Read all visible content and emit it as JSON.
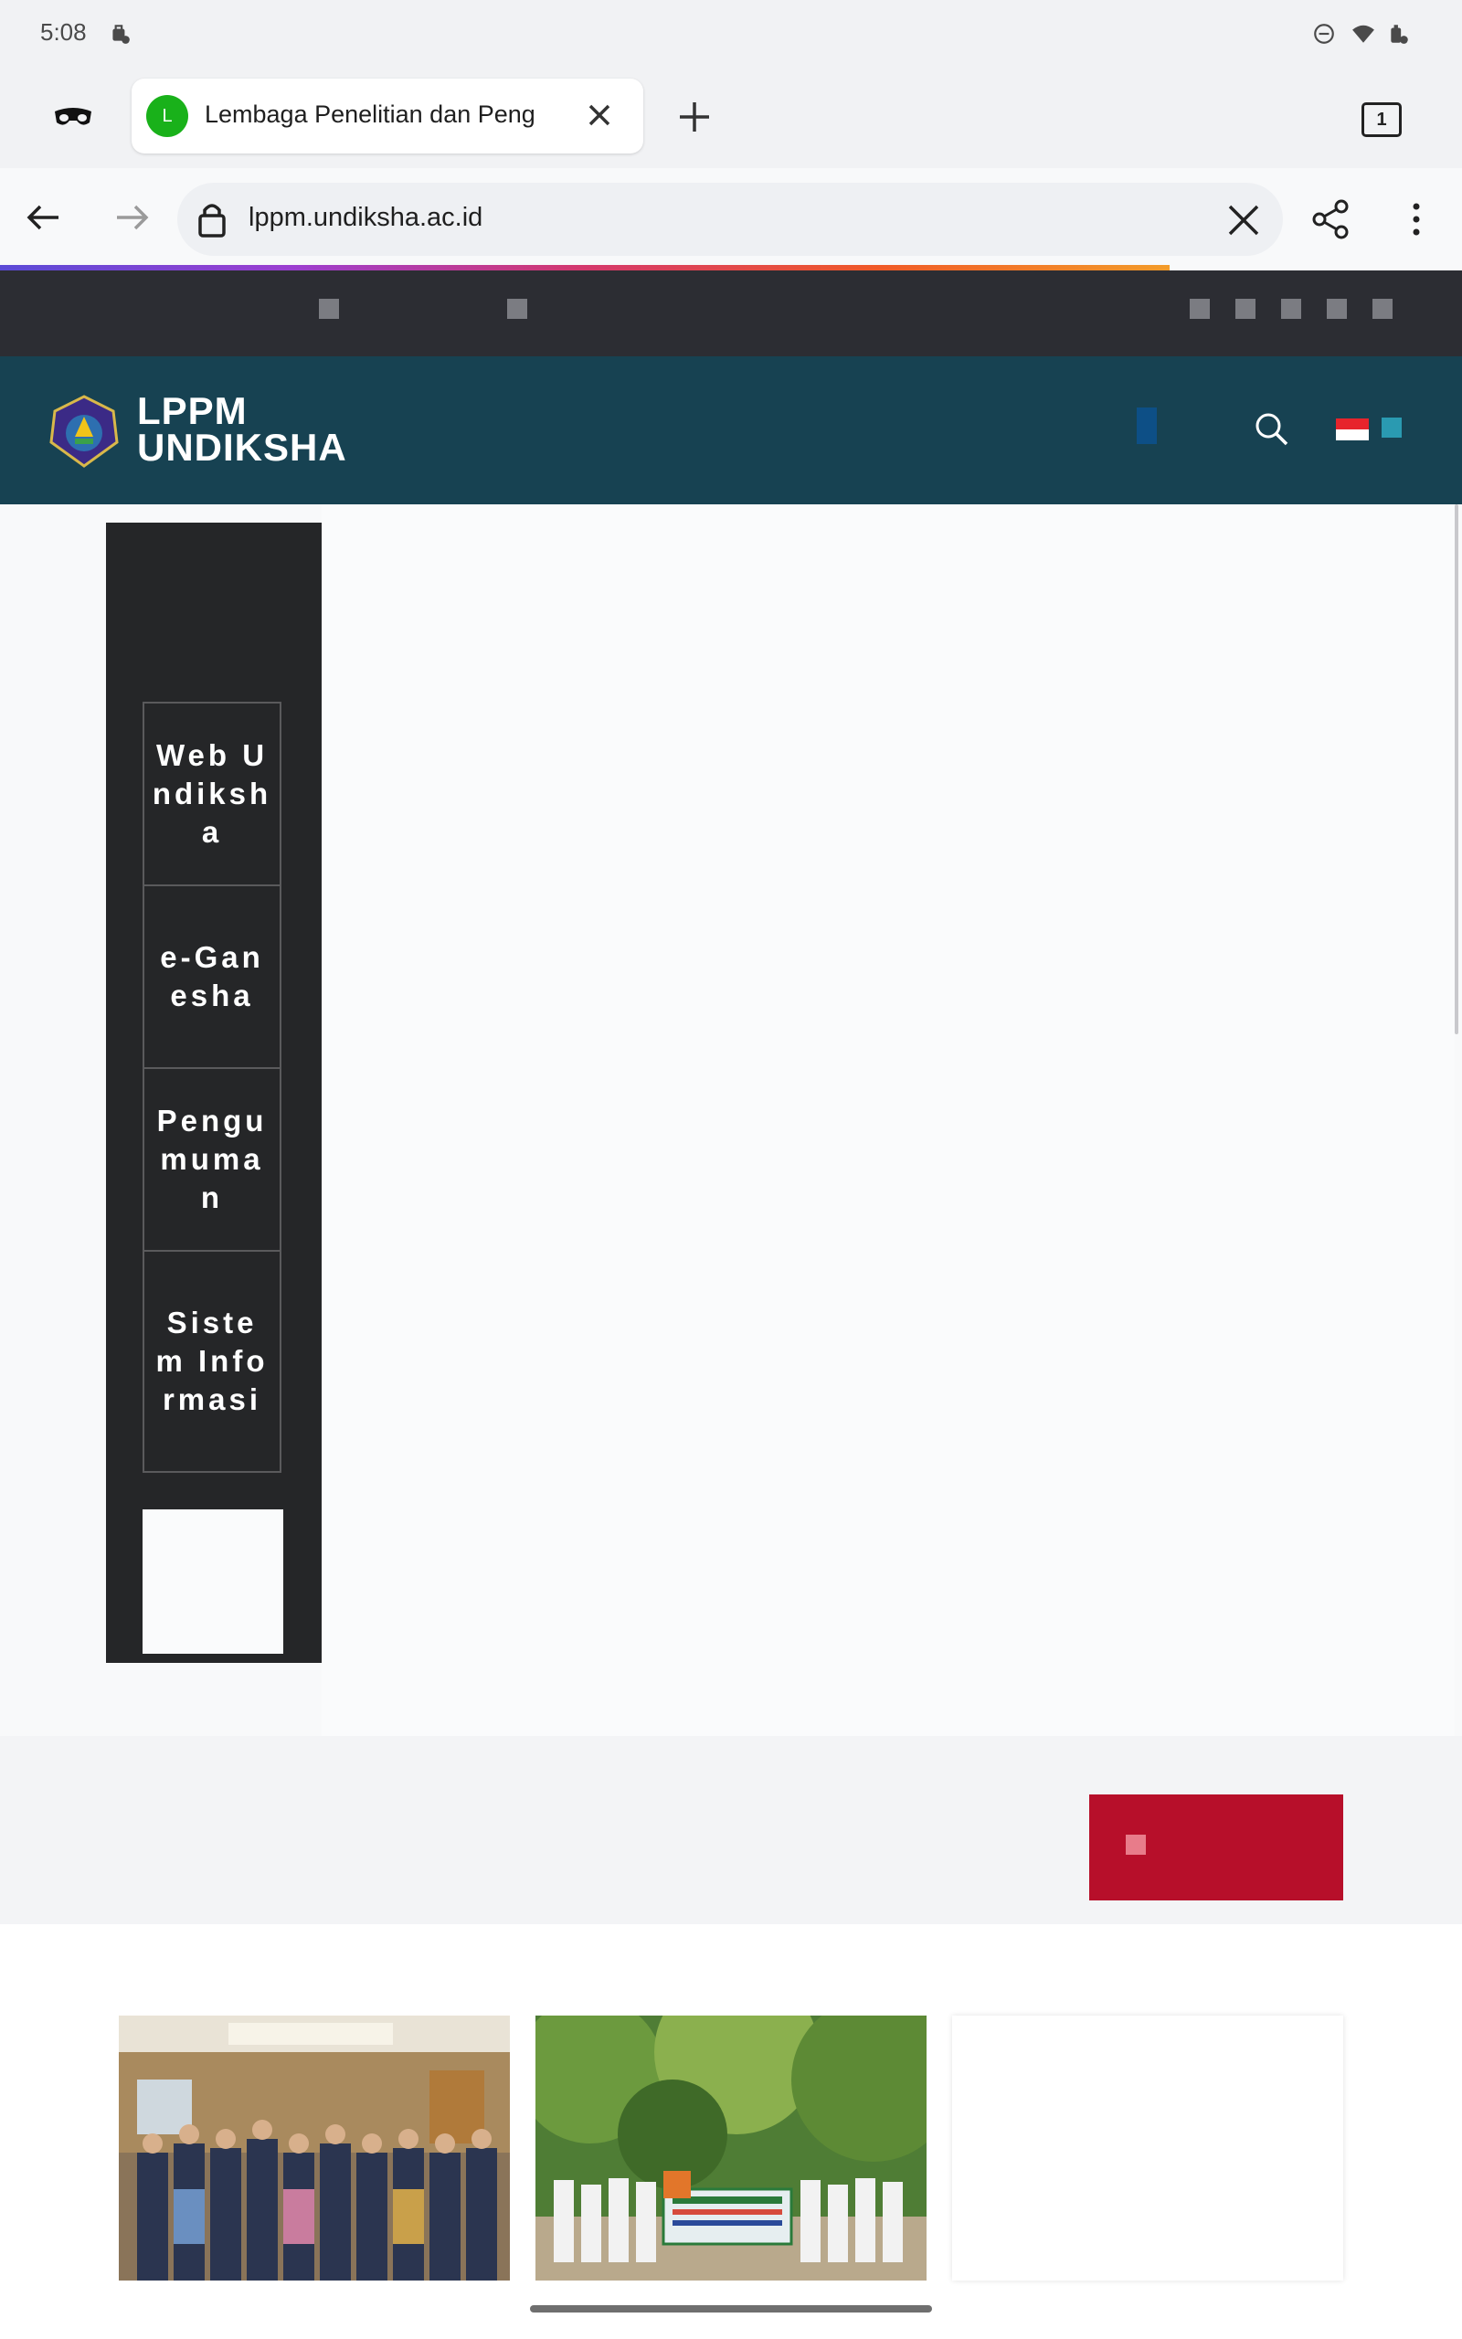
{
  "status_bar": {
    "time": "5:08"
  },
  "browser": {
    "tab": {
      "favicon_letter": "L",
      "title": "Lembaga Penelitian dan Peng",
      "close_icon": "close-icon"
    },
    "tab_count": "1",
    "url": "lppm.undiksha.ac.id"
  },
  "site": {
    "logo_line1": "LPPM",
    "logo_line2": "UNDIKSHA",
    "side_menu": [
      {
        "label": "Web Undiksha"
      },
      {
        "label": "e-Ganesha"
      },
      {
        "label": "Pengumuman"
      },
      {
        "label": "Sistem Informasi"
      }
    ]
  },
  "colors": {
    "header": "#174252",
    "topbar": "#2c2d33",
    "sidemenu": "#252628",
    "red_button": "#b70f2a"
  }
}
